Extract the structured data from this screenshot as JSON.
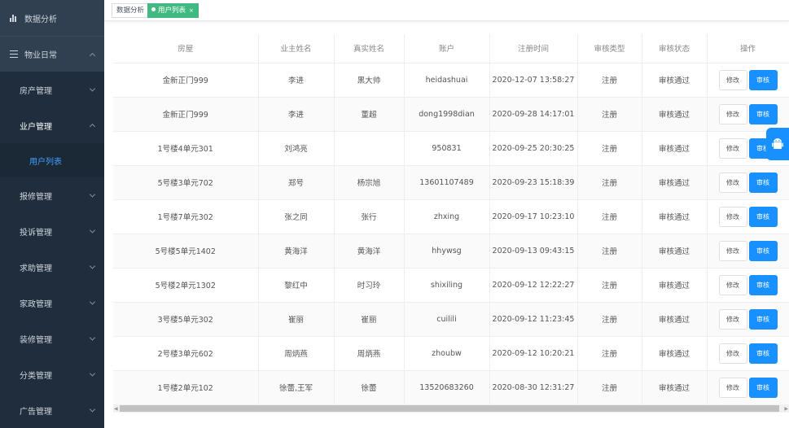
{
  "sidebar": {
    "top_item": "数据分析",
    "group": "物业日常",
    "items": [
      {
        "label": "房产管理"
      },
      {
        "label": "业户管理"
      },
      {
        "label": "用户列表"
      },
      {
        "label": "报修管理"
      },
      {
        "label": "投诉管理"
      },
      {
        "label": "求助管理"
      },
      {
        "label": "家政管理"
      },
      {
        "label": "装修管理"
      },
      {
        "label": "分类管理"
      },
      {
        "label": "广告管理"
      }
    ]
  },
  "tags": [
    {
      "label": "数据分析"
    },
    {
      "label": "用户列表",
      "close": "×"
    }
  ],
  "table": {
    "headers": [
      "房屋",
      "业主姓名",
      "真实姓名",
      "账户",
      "注册时间",
      "审核类型",
      "审核状态",
      "操作"
    ],
    "edit_label": "修改",
    "review_label": "审核",
    "rows": [
      [
        "金新正门999",
        "李进",
        "黑大帅",
        "heidashuai",
        "2020-12-07 13:58:27",
        "注册",
        "审核通过"
      ],
      [
        "金新正门999",
        "李进",
        "董超",
        "dong1998dian",
        "2020-09-28 14:17:01",
        "注册",
        "审核通过"
      ],
      [
        "1号楼4单元301",
        "刘鸿亮",
        "",
        "950831",
        "2020-09-25 20:30:25",
        "注册",
        "审核通过"
      ],
      [
        "5号楼3单元702",
        "郑号",
        "杨宗旭",
        "13601107489",
        "2020-09-23 15:18:39",
        "注册",
        "审核通过"
      ],
      [
        "1号楼7单元302",
        "张之同",
        "张行",
        "zhxing",
        "2020-09-17 10:23:10",
        "注册",
        "审核通过"
      ],
      [
        "5号楼5单元1402",
        "黄海洋",
        "黄海洋",
        "hhywsg",
        "2020-09-13 09:43:15",
        "注册",
        "审核通过"
      ],
      [
        "5号楼2单元1302",
        "黎红中",
        "时习玲",
        "shixiling",
        "2020-09-12 12:22:27",
        "注册",
        "审核通过"
      ],
      [
        "3号楼5单元302",
        "崔丽",
        "崔丽",
        "cuilili",
        "2020-09-12 11:23:45",
        "注册",
        "审核通过"
      ],
      [
        "2号楼3单元602",
        "周炳燕",
        "周炳燕",
        "zhoubw",
        "2020-09-12 10:20:21",
        "注册",
        "审核通过"
      ],
      [
        "1号楼2单元102",
        "徐蕾,王军",
        "徐蕾",
        "13520683260",
        "2020-08-30 12:31:27",
        "注册",
        "审核通过"
      ]
    ]
  }
}
